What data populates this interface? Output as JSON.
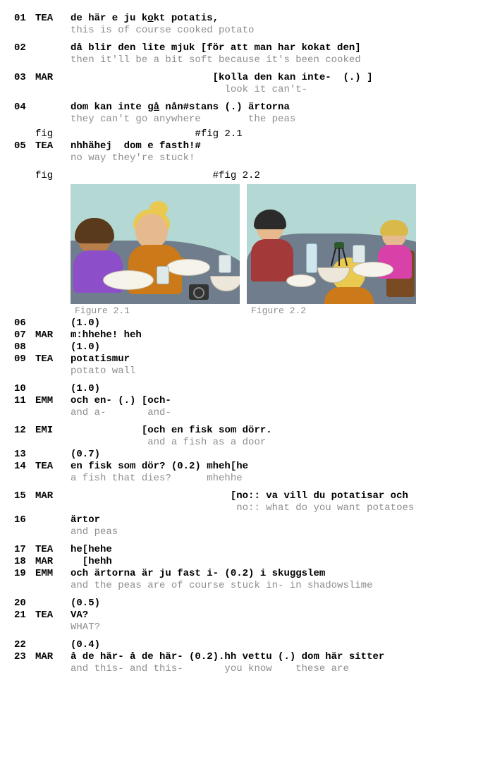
{
  "lines": [
    {
      "n": "01",
      "spk": "TEA",
      "main": [
        {
          "t": "de här e ju k"
        },
        {
          "t": "o",
          "u": true
        },
        {
          "t": "kt potatis,"
        }
      ],
      "gloss": "this is of course cooked potato"
    },
    {
      "gap": true
    },
    {
      "n": "02",
      "spk": "",
      "main": [
        {
          "t": "då blir den lite mjuk [för att man har kokat den]"
        }
      ],
      "gloss": "then it'll be a bit soft because it's been cooked"
    },
    {
      "gap": true
    },
    {
      "n": "03",
      "spk": "MAR",
      "pad": "                        ",
      "main": [
        {
          "t": "[kolla den kan inte-  (.) ]"
        }
      ],
      "glosspad": "                          ",
      "gloss": "look it can't-"
    },
    {
      "gap": true
    },
    {
      "n": "04",
      "spk": "",
      "main": [
        {
          "t": "dom kan inte "
        },
        {
          "t": "gå",
          "u": true
        },
        {
          "t": " nån#stans (.) ärtorna"
        }
      ],
      "gloss": "they can't go anywhere        the peas"
    },
    {
      "sgap": true
    },
    {
      "figref": true,
      "spk": "fig",
      "txt": "                     #fig 2.1"
    },
    {
      "n": "05",
      "spk": "TEA",
      "main": [
        {
          "t": "nhhähej  dom e fasth!#"
        }
      ],
      "gloss": "no way they're stuck!"
    },
    {
      "gap": true
    },
    {
      "figref": true,
      "spk": "fig",
      "txt": "                        #fig 2.2"
    },
    {
      "figs": true
    },
    {
      "n": "06",
      "spk": "",
      "main": [
        {
          "t": "(1.0)"
        }
      ]
    },
    {
      "n": "07",
      "spk": "MAR",
      "main": [
        {
          "t": "m:hhehe! heh"
        }
      ]
    },
    {
      "n": "08",
      "spk": "",
      "main": [
        {
          "t": "(1.0)"
        }
      ]
    },
    {
      "n": "09",
      "spk": "TEA",
      "main": [
        {
          "t": "potatismur"
        }
      ],
      "gloss": "potato wall"
    },
    {
      "gap": true
    },
    {
      "n": "10",
      "spk": "",
      "main": [
        {
          "t": "(1.0)"
        }
      ]
    },
    {
      "n": "11",
      "spk": "EMM",
      "main": [
        {
          "t": "och en- (.) [och-"
        }
      ],
      "gloss": "and a-       and-"
    },
    {
      "gap": true
    },
    {
      "n": "12",
      "spk": "EMI",
      "pad": "            ",
      "main": [
        {
          "t": "[och en fisk som dörr."
        }
      ],
      "glosspad": "             ",
      "gloss": "and a fish as a door"
    },
    {
      "n": "13",
      "spk": "",
      "main": [
        {
          "t": "(0.7)"
        }
      ]
    },
    {
      "n": "14",
      "spk": "TEA",
      "main": [
        {
          "t": "en fisk som dör? (0.2) mheh[he"
        }
      ],
      "gloss": "a fish that dies?      mhehhe"
    },
    {
      "gap": true
    },
    {
      "n": "15",
      "spk": "MAR",
      "pad": "                           ",
      "main": [
        {
          "t": "[no:: va vill du potatisar och"
        }
      ],
      "glosspad": "                            ",
      "gloss": "no:: what do you want potatoes"
    },
    {
      "n": "16",
      "spk": "",
      "main": [
        {
          "t": "ärtor"
        }
      ],
      "gloss": "and peas"
    },
    {
      "gap": true
    },
    {
      "n": "17",
      "spk": "TEA",
      "main": [
        {
          "t": "he[hehe"
        }
      ]
    },
    {
      "n": "18",
      "spk": "MAR",
      "main": [
        {
          "t": "  [hehh"
        }
      ]
    },
    {
      "n": "19",
      "spk": "EMM",
      "main": [
        {
          "t": "och ärtorna är ju fast i- (0.2) i skuggslem"
        }
      ],
      "gloss": "and the peas are of course stuck in- in shadowslime"
    },
    {
      "gap": true
    },
    {
      "n": "20",
      "spk": "",
      "main": [
        {
          "t": "(0.5)"
        }
      ]
    },
    {
      "n": "21",
      "spk": "TEA",
      "main": [
        {
          "t": "VA?"
        }
      ],
      "gloss": "WHAT?"
    },
    {
      "gap": true
    },
    {
      "n": "22",
      "spk": "",
      "main": [
        {
          "t": "(0.4)"
        }
      ]
    },
    {
      "n": "23",
      "spk": "MAR",
      "main": [
        {
          "t": "å de här- å de här- (0.2).hh vettu (.) dom här sitter"
        }
      ],
      "gloss": "and this- and this-       you know    these are"
    }
  ],
  "figures": {
    "cap1": "Figure 2.1",
    "cap2": "Figure 2.2"
  }
}
